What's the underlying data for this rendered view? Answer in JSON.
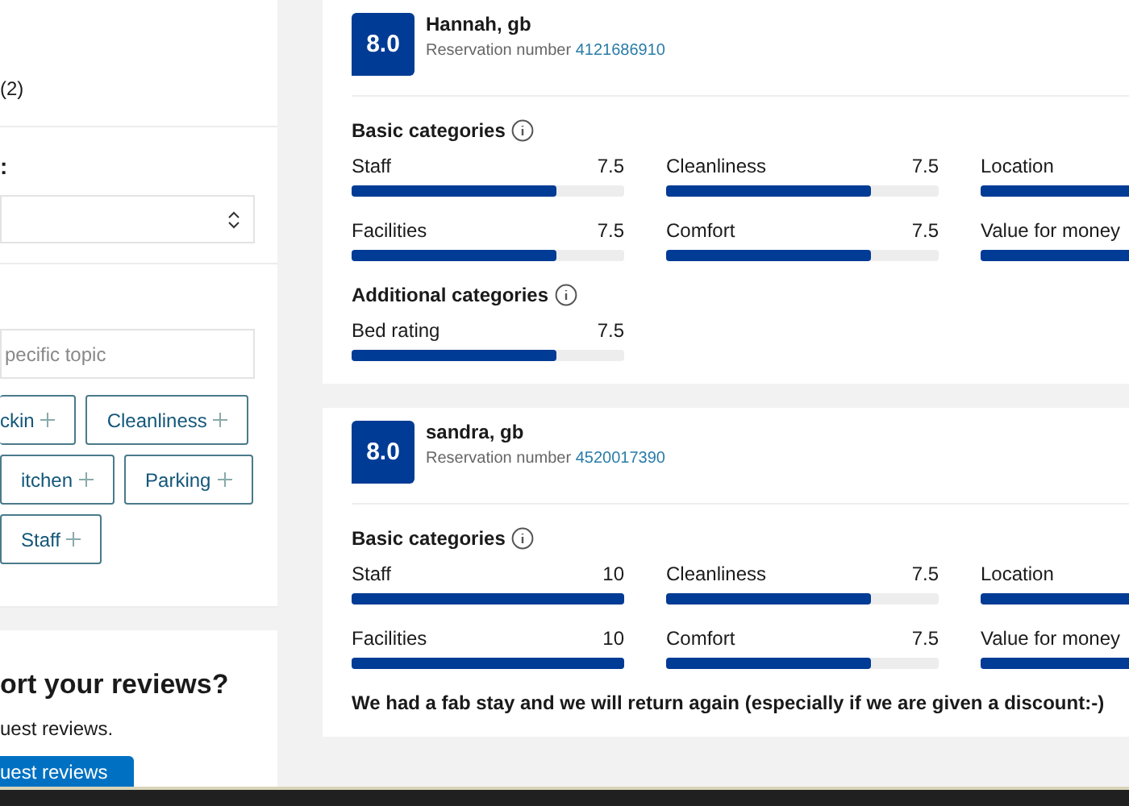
{
  "sidebar": {
    "count_text": "(2)",
    "sort_label": ":",
    "topic_search": {
      "placeholder": "pecific topic"
    },
    "topics": [
      {
        "label": "ckin"
      },
      {
        "label": "Cleanliness"
      },
      {
        "label": "itchen"
      },
      {
        "label": "Parking"
      },
      {
        "label": "Staff"
      }
    ],
    "import_card": {
      "title": "ort your reviews?",
      "text": "uest reviews.",
      "button": "uest reviews"
    }
  },
  "reviews": [
    {
      "score": "8.0",
      "name": "Hannah, gb",
      "reservation_label": "Reservation number",
      "reservation_number": "4121686910",
      "sections": [
        {
          "title": "Basic categories",
          "items": [
            {
              "label": "Staff",
              "value": "7.5",
              "level": 0.75
            },
            {
              "label": "Cleanliness",
              "value": "7.5",
              "level": 0.75
            },
            {
              "label": "Location",
              "level": 0.75
            },
            {
              "label": "Facilities",
              "value": "7.5",
              "level": 0.75
            },
            {
              "label": "Comfort",
              "value": "7.5",
              "level": 0.75
            },
            {
              "label": "Value for money",
              "level": 0.75
            }
          ]
        },
        {
          "title": "Additional categories",
          "items": [
            {
              "label": "Bed rating",
              "value": "7.5",
              "level": 0.75
            }
          ]
        }
      ]
    },
    {
      "score": "8.0",
      "name": "sandra, gb",
      "reservation_label": "Reservation number",
      "reservation_number": "4520017390",
      "sections": [
        {
          "title": "Basic categories",
          "items": [
            {
              "label": "Staff",
              "value": "10",
              "level": 1
            },
            {
              "label": "Cleanliness",
              "value": "7.5",
              "level": 0.75
            },
            {
              "label": "Location",
              "level": 0.75
            },
            {
              "label": "Facilities",
              "value": "10",
              "level": 1
            },
            {
              "label": "Comfort",
              "value": "7.5",
              "level": 0.75
            },
            {
              "label": "Value for money",
              "level": 0.75
            }
          ]
        }
      ],
      "comment": "We had a fab stay and we will return again (especially if we are given a discount:-)"
    }
  ]
}
